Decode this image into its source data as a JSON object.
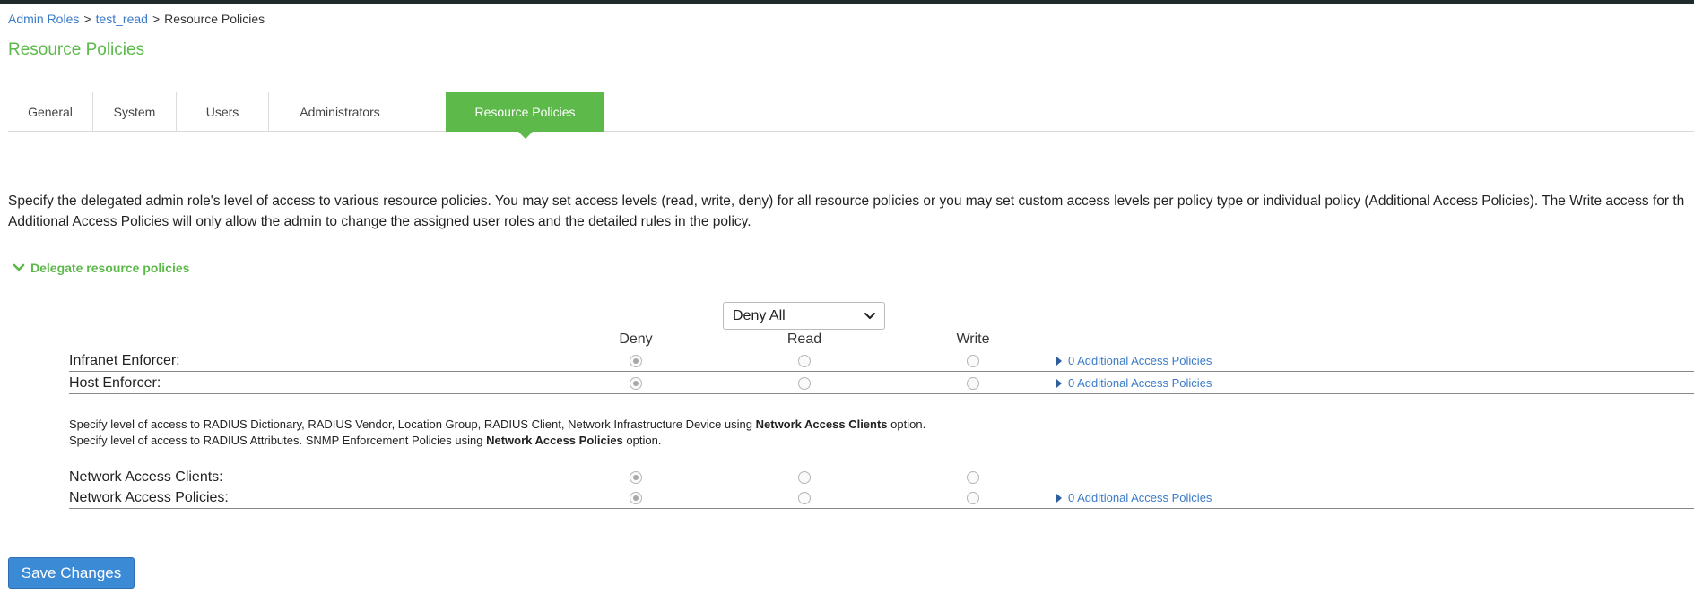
{
  "breadcrumb": {
    "items": [
      "Admin Roles",
      "test_read",
      "Resource Policies"
    ],
    "separator": ">"
  },
  "page_title": "Resource Policies",
  "tabs": [
    {
      "label": "General",
      "active": false
    },
    {
      "label": "System",
      "active": false
    },
    {
      "label": "Users",
      "active": false
    },
    {
      "label": "Administrators",
      "active": false
    },
    {
      "label": "Resource Policies",
      "active": true
    }
  ],
  "description": {
    "line1": "Specify the delegated admin role's level of access to various resource policies. You may set access levels (read, write, deny) for all resource policies or you may set custom access levels per policy type or individual policy (Additional Access Policies). The Write access for th",
    "line2": "Additional Access Policies will only allow the admin to change the assigned user roles and the detailed rules in the policy."
  },
  "section": {
    "label": "Delegate resource policies",
    "icon": "chevron-down-icon"
  },
  "all_access_select": {
    "selected": "Deny All"
  },
  "columns": [
    "Deny",
    "Read",
    "Write"
  ],
  "rows_group1": [
    {
      "label": "Infranet Enforcer:",
      "selected": "Deny",
      "additional": "0 Additional Access Policies"
    },
    {
      "label": "Host Enforcer:",
      "selected": "Deny",
      "additional": "0 Additional Access Policies"
    }
  ],
  "notes": {
    "note1_prefix": "Specify level of access to RADIUS Dictionary, RADIUS Vendor, Location Group, RADIUS Client, Network Infrastructure Device using ",
    "note1_bold": "Network Access Clients",
    "note1_suffix": " option.",
    "note2_prefix": "Specify level of access to RADIUS Attributes. SNMP Enforcement Policies using ",
    "note2_bold": "Network Access Policies",
    "note2_suffix": " option."
  },
  "rows_group2": [
    {
      "label": "Network Access Clients:",
      "selected": "Deny"
    },
    {
      "label": "Network Access Policies:",
      "selected": "Deny",
      "additional": "0 Additional Access Policies"
    }
  ],
  "save_button": "Save Changes",
  "colors": {
    "accent_green": "#5cb94a",
    "link_blue": "#3a7bc8",
    "button_blue": "#3b8ad6",
    "top_bar": "#1e2b2a"
  }
}
